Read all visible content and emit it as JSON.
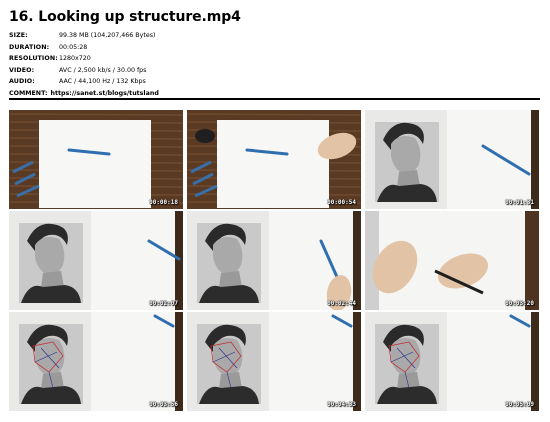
{
  "title": "16. Looking up structure.mp4",
  "meta": [
    {
      "key": "SIZE:",
      "value": "99.38 MB (104,207,466 Bytes)"
    },
    {
      "key": "DURATION:",
      "value": "00:05:28"
    },
    {
      "key": "RESOLUTION:",
      "value": "1280x720"
    },
    {
      "key": "VIDEO:",
      "value": "AVC / 2,500 kb/s / 30.00 fps"
    },
    {
      "key": "AUDIO:",
      "value": "AAC / 44,100 Hz / 132 Kbps"
    }
  ],
  "comment": {
    "key": "COMMENT:",
    "value": "https://sanet.st/blogs/tutsland"
  },
  "thumbnails": [
    {
      "timestamp": "00:00:18",
      "scene": "wood-pencils"
    },
    {
      "timestamp": "00:00:54",
      "scene": "wood-pencils-hand"
    },
    {
      "timestamp": "00:01:31",
      "scene": "ref-pencil"
    },
    {
      "timestamp": "00:02:07",
      "scene": "ref-pencil-up"
    },
    {
      "timestamp": "00:02:44",
      "scene": "ref-pencil-hand"
    },
    {
      "timestamp": "00:03:20",
      "scene": "hands-paper"
    },
    {
      "timestamp": "00:03:56",
      "scene": "ref-lines-pencil"
    },
    {
      "timestamp": "00:04:33",
      "scene": "ref-lines-pencil"
    },
    {
      "timestamp": "00:05:09",
      "scene": "ref-lines-pencil"
    }
  ]
}
